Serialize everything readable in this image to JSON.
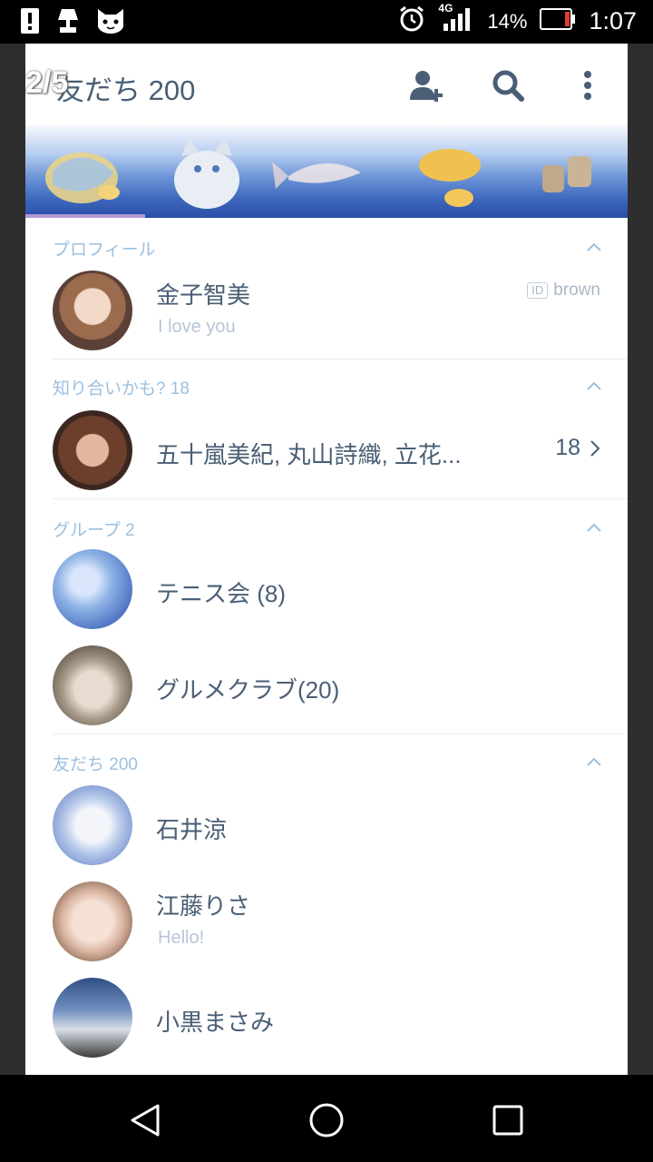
{
  "status_bar": {
    "network": "4G",
    "battery_percent": "14%",
    "time": "1:07",
    "icons_left": [
      "alert-icon",
      "lamp-icon",
      "cat-icon"
    ],
    "icons_right": [
      "alarm-icon",
      "signal-icon",
      "battery-icon"
    ]
  },
  "header": {
    "page_indicator": "2/5",
    "title": "友だち 200",
    "actions": [
      "add-friend-icon",
      "search-icon",
      "more-icon"
    ]
  },
  "profile_section": {
    "label": "プロフィール",
    "name": "金子智美",
    "status": "I love you",
    "id_tag": "ID",
    "id_value": "brown"
  },
  "suggest_section": {
    "label": "知り合いかも? 18",
    "names": "五十嵐美紀, 丸山詩織, 立花...",
    "count": "18"
  },
  "group_section": {
    "label": "グループ  2",
    "items": [
      {
        "name": "テニス会 (8)"
      },
      {
        "name": "グルメクラブ(20)"
      }
    ]
  },
  "friend_section": {
    "label": "友だち 200",
    "items": [
      {
        "name": "石井涼",
        "status": ""
      },
      {
        "name": "江藤りさ",
        "status": "Hello!"
      },
      {
        "name": "小黒まさみ",
        "status": ""
      }
    ]
  },
  "colors": {
    "name_text": "#4a5e75",
    "section_text": "#9cc0df",
    "tab_indicator": "#b39ad6"
  }
}
